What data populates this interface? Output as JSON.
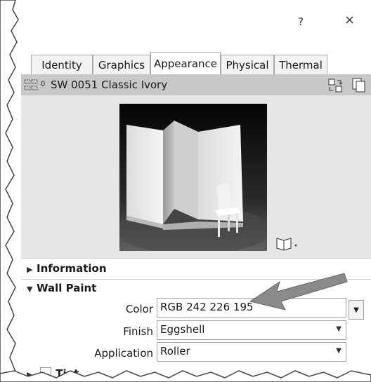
{
  "window": {
    "help_label": "?",
    "close_label": "×"
  },
  "tabs": [
    {
      "label": "Identity"
    },
    {
      "label": "Graphics"
    },
    {
      "label": "Appearance"
    },
    {
      "label": "Physical"
    },
    {
      "label": "Thermal"
    }
  ],
  "material": {
    "name": "SW 0051 Classic Ivory"
  },
  "sections": {
    "information": "Information",
    "wall_paint": "Wall Paint",
    "tint": "Tint"
  },
  "properties": {
    "color_label": "Color",
    "color_value": "RGB 242 226 195",
    "finish_label": "Finish",
    "finish_value": "Eggshell",
    "application_label": "Application",
    "application_value": "Roller"
  },
  "colors": {
    "arrow": "#8a8a8a",
    "material_bar": "#c8c8c8",
    "panel": "#e6e6e6"
  }
}
